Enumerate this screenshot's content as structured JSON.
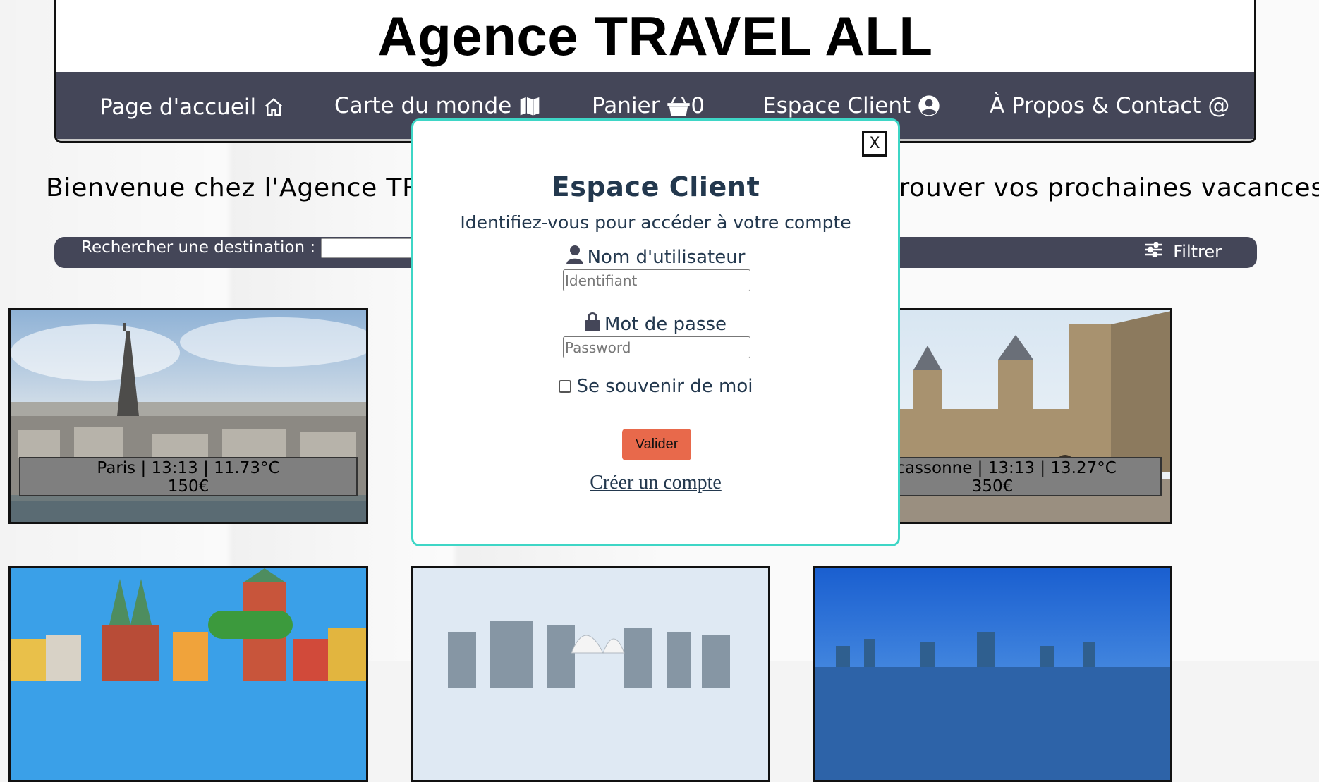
{
  "site": {
    "title": "Agence TRAVEL ALL"
  },
  "nav": {
    "items": [
      {
        "label": "Page d'accueil",
        "icon": "home-icon"
      },
      {
        "label": "Carte du monde",
        "icon": "map-icon"
      },
      {
        "label": "Panier",
        "icon": "basket-icon",
        "count": "0"
      },
      {
        "label": "Espace Client",
        "icon": "user-circle-icon"
      },
      {
        "label": "À Propos & Contact @",
        "icon": ""
      }
    ]
  },
  "welcome": {
    "text": "Bienvenue chez l'Agence TRAVEL ALL, nous allons vous aider à trouver vos prochaines vacances !"
  },
  "search": {
    "label": "Rechercher une destination :",
    "value": "",
    "filter_label": "Filtrer"
  },
  "destinations": [
    {
      "caption_line1": "Paris | 13:13 | 11.73°C",
      "caption_line2": "150€",
      "image": "eiffel-tower-cityscape"
    },
    {
      "caption_line1": "",
      "caption_line2": "",
      "image": "hidden-by-modal"
    },
    {
      "caption_line1": "Carcassonne | 13:13 | 13.27°C",
      "caption_line2": "350€",
      "image": "medieval-castle-walls"
    },
    {
      "caption_line1": "",
      "caption_line2": "",
      "image": "colorful-gothic-town"
    },
    {
      "caption_line1": "",
      "caption_line2": "",
      "image": "harbour-skyline-opera"
    },
    {
      "caption_line1": "",
      "caption_line2": "",
      "image": "blue-sky-coastal-city"
    }
  ],
  "modal": {
    "close_label": "X",
    "title": "Espace Client",
    "subtitle": "Identifiez-vous pour accéder à votre compte",
    "username_label": "Nom d'utilisateur",
    "username_placeholder": "Identifiant",
    "password_label": "Mot de passe",
    "password_placeholder": "Password",
    "remember_label": "Se souvenir de moi",
    "submit_label": "Valider",
    "create_account_label": "Créer un compte"
  },
  "colors": {
    "nav_bg": "#444658",
    "modal_border": "#3ed6c6",
    "accent_button": "#e8694b",
    "modal_text": "#23384e",
    "caption_bg": "#7f7f7f"
  }
}
